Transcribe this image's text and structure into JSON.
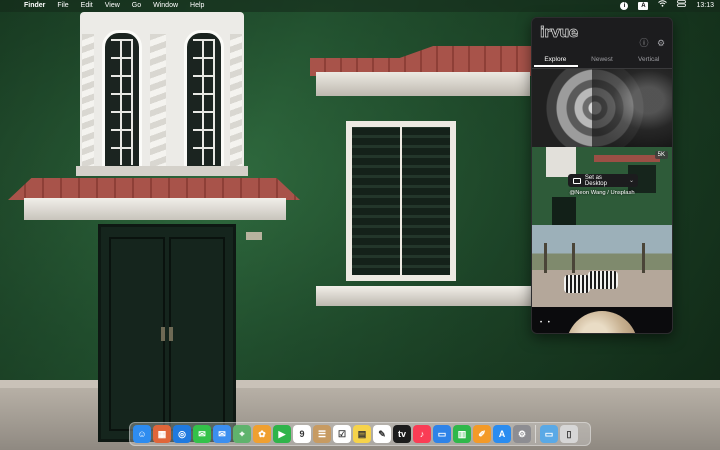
{
  "menubar": {
    "apple_glyph": "",
    "app_name": "Finder",
    "items": [
      "File",
      "Edit",
      "View",
      "Go",
      "Window",
      "Help"
    ],
    "input_source": "A",
    "clock": "13:13"
  },
  "popover": {
    "logo_text": "irvue",
    "tabs": [
      "Explore",
      "Newest",
      "Vertical"
    ],
    "active_tab": "Explore",
    "badge": "5K",
    "set_as_desktop_label": "Set as Desktop",
    "photo_credit": "@Neon Wang / Unsplash"
  },
  "dock": {
    "apps": [
      {
        "name": "finder",
        "color": "#2d8cf0",
        "glyph": "☺"
      },
      {
        "name": "launchpad",
        "color": "#e0663a",
        "glyph": "▦"
      },
      {
        "name": "safari",
        "color": "#1f7ae0",
        "glyph": "◎"
      },
      {
        "name": "messages",
        "color": "#33c24a",
        "glyph": "✉"
      },
      {
        "name": "mail",
        "color": "#3b8ff0",
        "glyph": "✉"
      },
      {
        "name": "maps",
        "color": "#5fb36d",
        "glyph": "⌖"
      },
      {
        "name": "photos",
        "color": "#f0a030",
        "glyph": "✿"
      },
      {
        "name": "facetime",
        "color": "#2fb44a",
        "glyph": "▶"
      },
      {
        "name": "calendar",
        "color": "#ffffff",
        "glyph": "9"
      },
      {
        "name": "contacts",
        "color": "#c79b62",
        "glyph": "☰"
      },
      {
        "name": "reminders",
        "color": "#ffffff",
        "glyph": "☑"
      },
      {
        "name": "notes",
        "color": "#f6d34a",
        "glyph": "▤"
      },
      {
        "name": "freeform",
        "color": "#ffffff",
        "glyph": "✎"
      },
      {
        "name": "tv",
        "color": "#1c1c1c",
        "glyph": "tv"
      },
      {
        "name": "music",
        "color": "#fa3c55",
        "glyph": "♪"
      },
      {
        "name": "keynote",
        "color": "#2e83e8",
        "glyph": "▭"
      },
      {
        "name": "numbers",
        "color": "#2fb84a",
        "glyph": "▥"
      },
      {
        "name": "pages",
        "color": "#f39a28",
        "glyph": "✐"
      },
      {
        "name": "app-store",
        "color": "#2a8cf0",
        "glyph": "A"
      },
      {
        "name": "system-settings",
        "color": "#8d8d92",
        "glyph": "⚙"
      }
    ],
    "trailing": [
      {
        "name": "downloads-folder",
        "color": "#5aa9e6",
        "glyph": "▭"
      },
      {
        "name": "trash",
        "color": "#d6d6d6",
        "glyph": "▯"
      }
    ]
  }
}
